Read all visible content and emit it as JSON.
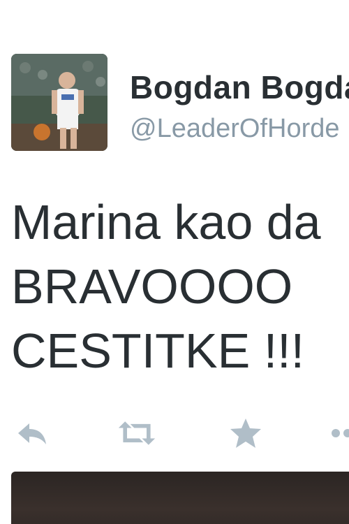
{
  "tweet": {
    "author": {
      "display_name": "Bogdan Bogdanović",
      "handle": "@LeaderOfHorde"
    },
    "text_lines": [
      "Marina kao da",
      "BRAVOOOO",
      "CESTITKE !!!"
    ],
    "actions": {
      "reply": "reply-icon",
      "retweet": "retweet-icon",
      "favorite": "star-icon",
      "more": "more-icon"
    }
  },
  "colors": {
    "text": "#292f33",
    "secondary": "#8899a6",
    "icon": "#b0bec8"
  }
}
